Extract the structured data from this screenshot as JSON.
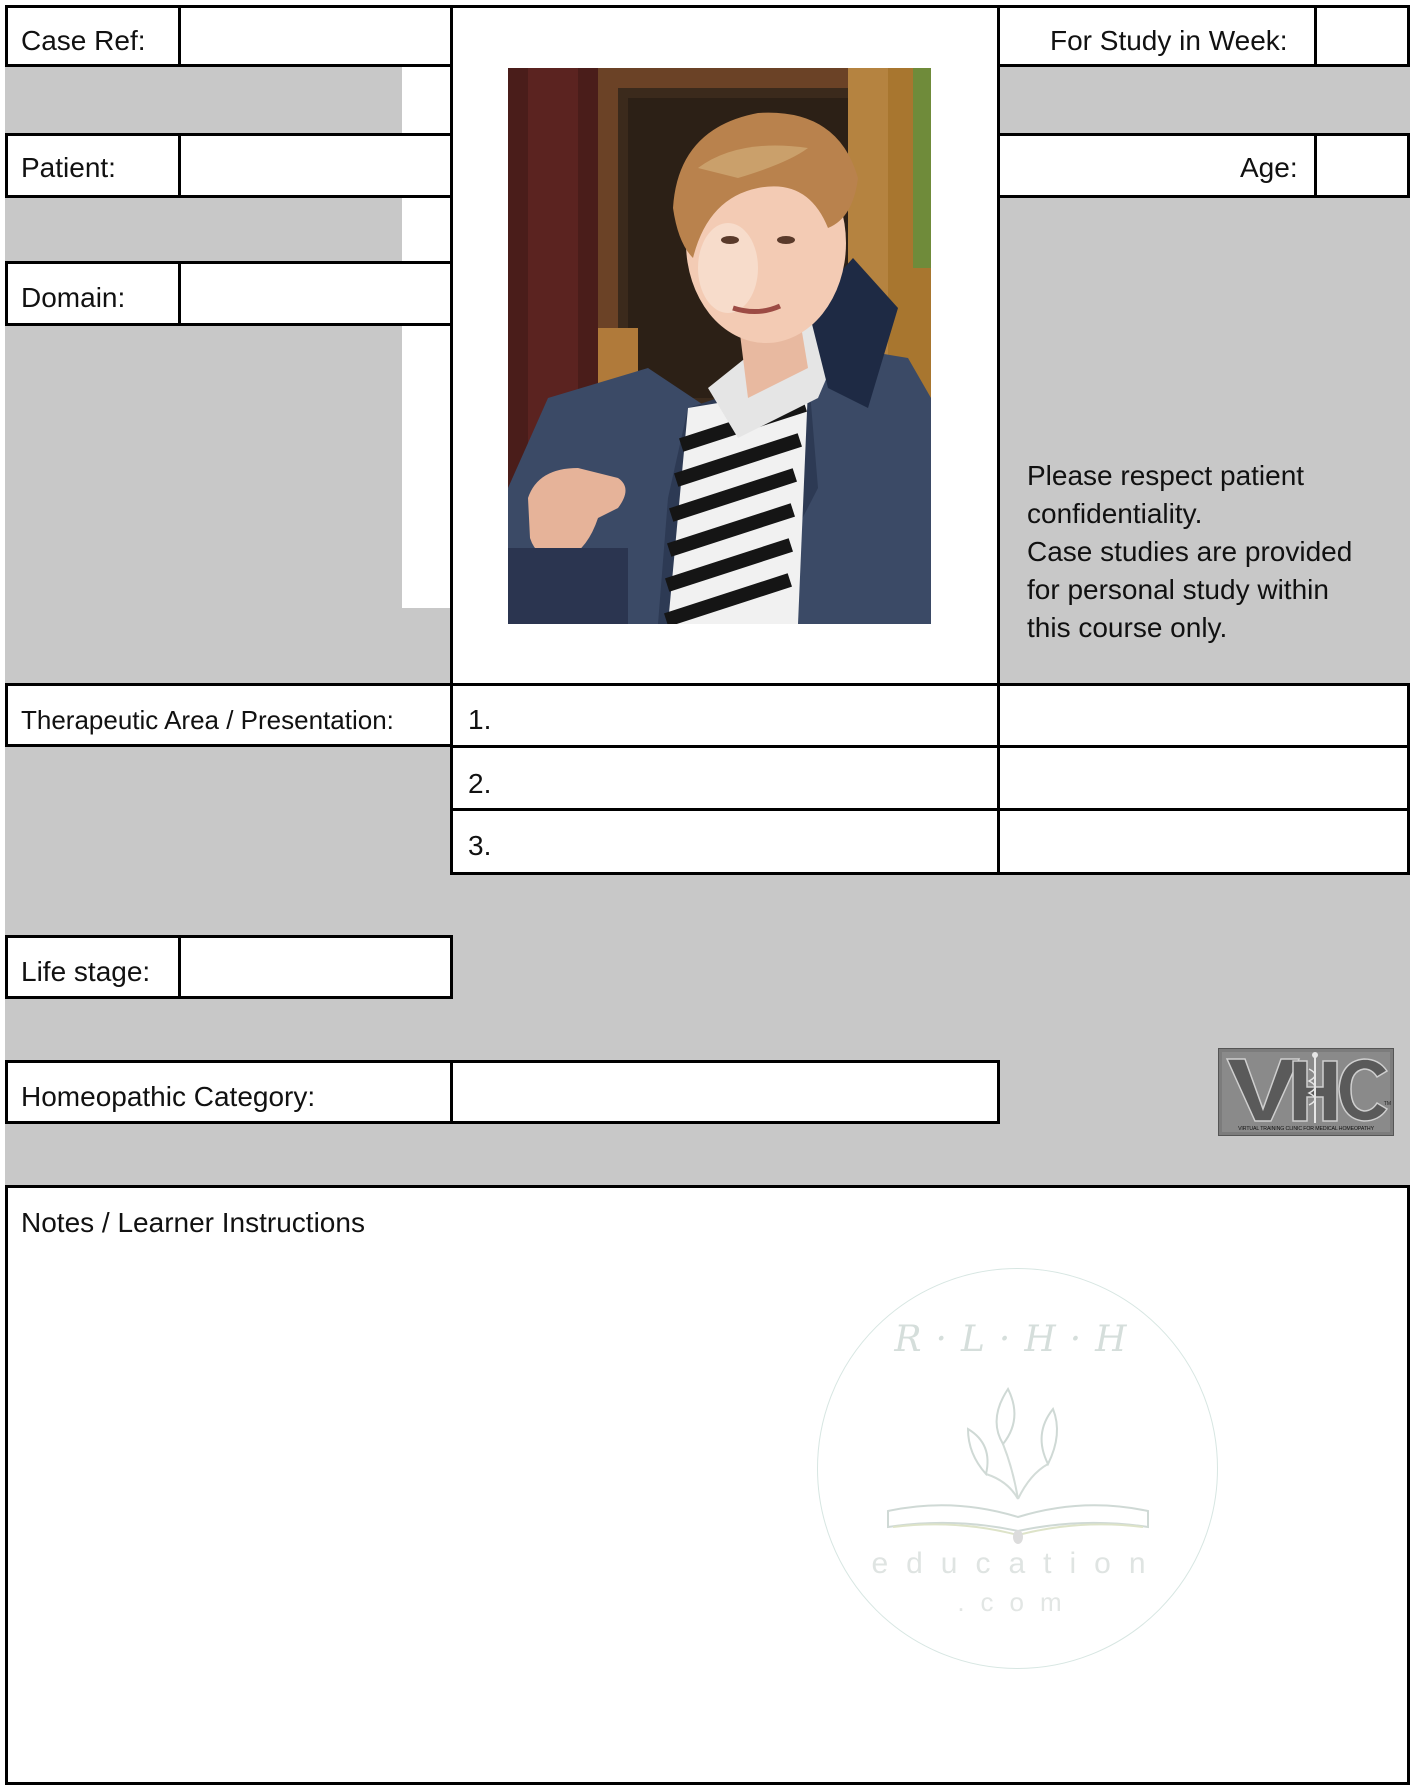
{
  "form": {
    "case_ref_label": "Case Ref:",
    "case_ref_value": "",
    "week_label": "For Study in Week:",
    "week_value": "",
    "patient_label": "Patient:",
    "patient_value": "",
    "age_label": "Age:",
    "age_value": "",
    "domain_label": "Domain:",
    "domain_value": "",
    "therapeutic_label": "Therapeutic Area / Presentation:",
    "items": [
      {
        "num": "1.",
        "value": "",
        "extra": ""
      },
      {
        "num": "2.",
        "value": "",
        "extra": ""
      },
      {
        "num": "3.",
        "value": "",
        "extra": ""
      }
    ],
    "life_stage_label": "Life stage:",
    "life_stage_value": "",
    "homeopathic_label": "Homeopathic Category:",
    "homeopathic_value": "",
    "notes_label": "Notes / Learner Instructions"
  },
  "notice": {
    "lines": [
      "Please respect patient",
      "confidentiality.",
      "Case studies are provided",
      "for personal study within",
      "this course only."
    ]
  },
  "vhc_logo": {
    "text": "VHC",
    "caption": "VIRTUAL TRAINING CLINIC FOR MEDICAL HOMEOPATHY",
    "tm": "TM"
  },
  "watermark": {
    "top": "R·L·H·H",
    "main": "education",
    "sub": ".com"
  },
  "colors": {
    "panel_gray": "#c8c8c8",
    "border": "#000000",
    "watermark": "#c9d6d2"
  },
  "photo": {
    "subject": "woman with short auburn hair, navy jacket, black-and-white striped top, gesturing with hand"
  }
}
